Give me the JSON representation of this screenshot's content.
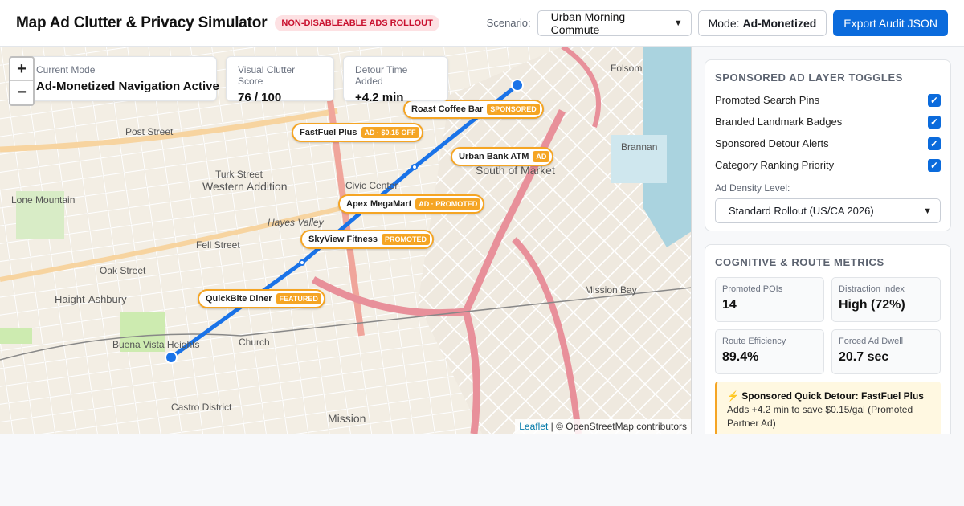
{
  "header": {
    "title": "Map Ad Clutter & Privacy Simulator",
    "badge": "NON-DISABLEABLE ADS ROLLOUT",
    "scenario_label": "Scenario:",
    "scenario_value": "Urban Morning Commute",
    "mode_label": "Mode:",
    "mode_value": "Ad-Monetized",
    "export_label": "Export Audit JSON"
  },
  "map": {
    "zoom_in": "+",
    "zoom_out": "−",
    "stats": [
      {
        "label": "Current Mode",
        "value": "Ad-Monetized Navigation Active"
      },
      {
        "label": "Visual Clutter Score",
        "value": "76 / 100"
      },
      {
        "label": "Detour Time Added",
        "value": "+4.2 min"
      }
    ],
    "pois": [
      {
        "name": "Roast Coffee Bar",
        "tag": "SPONSORED"
      },
      {
        "name": "FastFuel Plus",
        "tag": "AD · $0.15 OFF"
      },
      {
        "name": "Urban Bank ATM",
        "tag": "AD"
      },
      {
        "name": "Apex MegaMart",
        "tag": "AD · PROMOTED"
      },
      {
        "name": "SkyView Fitness",
        "tag": "PROMOTED"
      },
      {
        "name": "QuickBite Diner",
        "tag": "FEATURED"
      }
    ],
    "labels": {
      "western_addition": "Western Addition",
      "civic_center": "Civic Center",
      "south_of_market": "South of Market",
      "haight_ashbury": "Haight-Ashbury",
      "mission_bay": "Mission Bay",
      "mission": "Mission",
      "castro": "Castro District",
      "folsom": "Folsom",
      "brannan": "Brannan",
      "hayes": "Hayes Valley",
      "lone_mountain": "Lone Mountain",
      "post_street": "Post Street",
      "turk_street": "Turk Street",
      "fell_street": "Fell Street",
      "oak_street": "Oak Street",
      "church": "Church",
      "buena_vista": "Buena Vista Heights"
    },
    "attribution_leaflet": "Leaflet",
    "attribution_rest": "| © OpenStreetMap contributors"
  },
  "sidebar": {
    "toggles_title": "SPONSORED AD LAYER TOGGLES",
    "toggles": [
      {
        "label": "Promoted Search Pins",
        "checked": true
      },
      {
        "label": "Branded Landmark Badges",
        "checked": true
      },
      {
        "label": "Sponsored Detour Alerts",
        "checked": true
      },
      {
        "label": "Category Ranking Priority",
        "checked": true
      }
    ],
    "density_label": "Ad Density Level:",
    "density_value": "Standard Rollout (US/CA 2026)",
    "metrics_title": "COGNITIVE & ROUTE METRICS",
    "metrics": [
      {
        "label": "Promoted POIs",
        "value": "14"
      },
      {
        "label": "Distraction Index",
        "value": "High (72%)"
      },
      {
        "label": "Route Efficiency",
        "value": "89.4%"
      },
      {
        "label": "Forced Ad Dwell",
        "value": "20.7 sec"
      }
    ],
    "alert_title": "⚡ Sponsored Quick Detour: FastFuel Plus",
    "alert_body": "Adds +4.2 min to save $0.15/gal (Promoted Partner Ad)"
  },
  "colors": {
    "accent": "#0b6bdc",
    "ad_orange": "#f5a524",
    "badge_red": "#c8102e",
    "route_blue": "#1a73e8"
  }
}
